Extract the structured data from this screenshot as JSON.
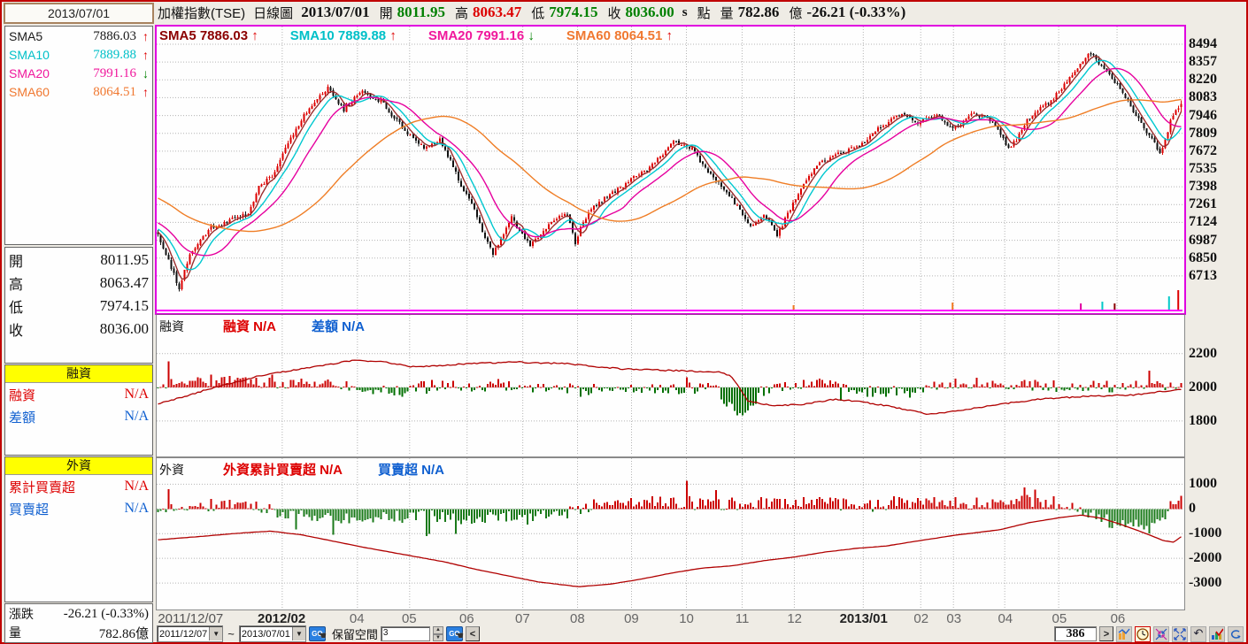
{
  "window": {
    "date_display": "2013/07/01"
  },
  "header": {
    "tokens": [
      {
        "text": "加權指數(TSE)",
        "cls": "t-title"
      },
      {
        "text": "日線圖",
        "cls": "t-title"
      },
      {
        "text": "2013/07/01",
        "cls": "t-date"
      },
      {
        "text": "開",
        "cls": "t-lab"
      },
      {
        "text": "8011.95",
        "cls": "t-num green"
      },
      {
        "text": "高",
        "cls": "t-lab"
      },
      {
        "text": "8063.47",
        "cls": "t-num red"
      },
      {
        "text": "低",
        "cls": "t-lab"
      },
      {
        "text": "7974.15",
        "cls": "t-num green"
      },
      {
        "text": "收",
        "cls": "t-lab"
      },
      {
        "text": "8036.00",
        "cls": "t-num green"
      },
      {
        "text": "s",
        "cls": "t-s"
      },
      {
        "text": "點",
        "cls": "t-lab"
      },
      {
        "text": "量",
        "cls": "t-lab"
      },
      {
        "text": "782.86",
        "cls": "t-num"
      },
      {
        "text": "億",
        "cls": "t-lab"
      },
      {
        "text": "-26.21 (-0.33%)",
        "cls": "t-num"
      }
    ]
  },
  "sidebar": {
    "sma_rows": [
      {
        "label": "SMA5",
        "value": "7886.03",
        "dir": "up",
        "color": "#1a1a1a"
      },
      {
        "label": "SMA10",
        "value": "7889.88",
        "dir": "up",
        "color": "#00c0c8"
      },
      {
        "label": "SMA20",
        "value": "7991.16",
        "dir": "down",
        "color": "#f0189c"
      },
      {
        "label": "SMA60",
        "value": "8064.51",
        "dir": "up",
        "color": "#f07830"
      }
    ],
    "ohlc_rows": [
      {
        "label": "開",
        "value": "8011.95"
      },
      {
        "label": "高",
        "value": "8063.47"
      },
      {
        "label": "低",
        "value": "7974.15"
      },
      {
        "label": "收",
        "value": "8036.00"
      }
    ],
    "margin_box": {
      "header": "融資",
      "rows": [
        {
          "label": "融資",
          "value": "N/A",
          "color": "#dd0000"
        },
        {
          "label": "差額",
          "value": "N/A",
          "color": "#1060d0"
        }
      ]
    },
    "foreign_box": {
      "header": "外資",
      "rows": [
        {
          "label": "累計買賣超",
          "value": "N/A",
          "color": "#dd0000"
        },
        {
          "label": "買賣超",
          "value": "N/A",
          "color": "#1060d0"
        }
      ]
    },
    "change_rows": [
      {
        "label": "漲跌",
        "value": "-26.21 (-0.33%)"
      },
      {
        "label": "量",
        "value": "782.86億"
      }
    ]
  },
  "panels": {
    "main": {
      "legend": [
        {
          "label": "SMA5",
          "value": "7886.03",
          "dir": "up",
          "color": "#8b0000"
        },
        {
          "label": "SMA10",
          "value": "7889.88",
          "dir": "up",
          "color": "#00c0c8"
        },
        {
          "label": "SMA20",
          "value": "7991.16",
          "dir": "down",
          "color": "#f0189c"
        },
        {
          "label": "SMA60",
          "value": "8064.51",
          "dir": "up",
          "color": "#f07830"
        }
      ],
      "y_ticks": [
        8494,
        8357,
        8220,
        8083,
        7946,
        7809,
        7672,
        7535,
        7398,
        7261,
        7124,
        6987,
        6850,
        6713
      ]
    },
    "mid": {
      "title": "融資",
      "legend": [
        {
          "label": "融資",
          "value": "N/A",
          "color": "#dd0000"
        },
        {
          "label": "差額",
          "value": "N/A",
          "color": "#1060d0"
        }
      ],
      "y_ticks": [
        2200,
        2000,
        1800
      ]
    },
    "bot": {
      "title": "外資",
      "legend": [
        {
          "label": "外資累計買賣超",
          "value": "N/A",
          "color": "#dd0000"
        },
        {
          "label": "買賣超",
          "value": "N/A",
          "color": "#1060d0"
        }
      ],
      "y_ticks": [
        1000,
        0,
        -1000,
        -2000,
        -3000
      ]
    }
  },
  "x_axis": {
    "labels": [
      {
        "text": "2011/12/07",
        "t": 0.002,
        "bold": false,
        "first": true
      },
      {
        "text": "2012/02",
        "t": 0.1224,
        "bold": true
      },
      {
        "text": "04",
        "t": 0.1957,
        "bold": false
      },
      {
        "text": "05",
        "t": 0.2466,
        "bold": false
      },
      {
        "text": "06",
        "t": 0.3026,
        "bold": false
      },
      {
        "text": "07",
        "t": 0.3569,
        "bold": false
      },
      {
        "text": "08",
        "t": 0.4103,
        "bold": false
      },
      {
        "text": "09",
        "t": 0.4629,
        "bold": false
      },
      {
        "text": "10",
        "t": 0.5164,
        "bold": false
      },
      {
        "text": "11",
        "t": 0.5707,
        "bold": false
      },
      {
        "text": "12",
        "t": 0.6216,
        "bold": false
      },
      {
        "text": "2013/01",
        "t": 0.6888,
        "bold": true
      },
      {
        "text": "02",
        "t": 0.7448,
        "bold": false
      },
      {
        "text": "03",
        "t": 0.7767,
        "bold": false
      },
      {
        "text": "04",
        "t": 0.8267,
        "bold": false
      },
      {
        "text": "05",
        "t": 0.8793,
        "bold": false
      },
      {
        "text": "06",
        "t": 0.9362,
        "bold": false
      }
    ]
  },
  "toolbar": {
    "from_date": "2011/12/07",
    "tilde": "~",
    "to_date": "2013/07/01",
    "go_label": "GO",
    "space_label": "保留空間",
    "space_value": "3",
    "back_label": "<",
    "count": "386",
    "forward_label": ">"
  },
  "chart_data": {
    "type": "candlestick",
    "title": "加權指數(TSE) 日線圖 2013/07/01",
    "candle_count": 386,
    "price_ylim": [
      6440,
      8630
    ],
    "last_candle": {
      "open": 8011.95,
      "high": 8063.47,
      "low": 7974.15,
      "close": 8036.0
    },
    "sma": [
      {
        "period": 5,
        "color": "#9b2d2d"
      },
      {
        "period": 10,
        "color": "#00c8d0"
      },
      {
        "period": 20,
        "color": "#e6009e"
      },
      {
        "period": 60,
        "color": "#ef7d25"
      }
    ],
    "up_color": "#dd0000",
    "down_color": "#111111",
    "price_anchors": [
      [
        0,
        7030
      ],
      [
        4,
        6830
      ],
      [
        8,
        6620
      ],
      [
        12,
        6870
      ],
      [
        15,
        6960
      ],
      [
        20,
        7080
      ],
      [
        25,
        7120
      ],
      [
        30,
        7170
      ],
      [
        34,
        7190
      ],
      [
        38,
        7400
      ],
      [
        43,
        7480
      ],
      [
        47,
        7650
      ],
      [
        51,
        7800
      ],
      [
        55,
        7950
      ],
      [
        58,
        8020
      ],
      [
        61,
        8100
      ],
      [
        64,
        8160
      ],
      [
        67,
        8060
      ],
      [
        70,
        7990
      ],
      [
        73,
        8060
      ],
      [
        77,
        8130
      ],
      [
        80,
        8080
      ],
      [
        84,
        8060
      ],
      [
        88,
        7950
      ],
      [
        92,
        7860
      ],
      [
        96,
        7760
      ],
      [
        100,
        7700
      ],
      [
        103,
        7730
      ],
      [
        106,
        7760
      ],
      [
        109,
        7640
      ],
      [
        112,
        7500
      ],
      [
        115,
        7370
      ],
      [
        118,
        7260
      ],
      [
        121,
        7120
      ],
      [
        124,
        6960
      ],
      [
        126,
        6880
      ],
      [
        129,
        7000
      ],
      [
        133,
        7160
      ],
      [
        136,
        7060
      ],
      [
        140,
        6940
      ],
      [
        143,
        7010
      ],
      [
        147,
        7110
      ],
      [
        151,
        7170
      ],
      [
        154,
        7190
      ],
      [
        156,
        7030
      ],
      [
        157,
        6950
      ],
      [
        159,
        7080
      ],
      [
        162,
        7210
      ],
      [
        166,
        7280
      ],
      [
        171,
        7350
      ],
      [
        175,
        7400
      ],
      [
        178,
        7460
      ],
      [
        182,
        7510
      ],
      [
        186,
        7560
      ],
      [
        190,
        7650
      ],
      [
        194,
        7740
      ],
      [
        198,
        7720
      ],
      [
        201,
        7690
      ],
      [
        205,
        7570
      ],
      [
        209,
        7460
      ],
      [
        213,
        7390
      ],
      [
        216,
        7310
      ],
      [
        220,
        7180
      ],
      [
        223,
        7090
      ],
      [
        226,
        7150
      ],
      [
        228,
        7190
      ],
      [
        231,
        7100
      ],
      [
        233,
        7020
      ],
      [
        236,
        7150
      ],
      [
        240,
        7310
      ],
      [
        244,
        7440
      ],
      [
        248,
        7560
      ],
      [
        252,
        7610
      ],
      [
        257,
        7660
      ],
      [
        261,
        7690
      ],
      [
        264,
        7710
      ],
      [
        268,
        7790
      ],
      [
        272,
        7860
      ],
      [
        276,
        7910
      ],
      [
        280,
        7960
      ],
      [
        283,
        7930
      ],
      [
        286,
        7890
      ],
      [
        290,
        7930
      ],
      [
        293,
        7960
      ],
      [
        296,
        7900
      ],
      [
        299,
        7840
      ],
      [
        303,
        7900
      ],
      [
        306,
        7960
      ],
      [
        310,
        7940
      ],
      [
        313,
        7910
      ],
      [
        317,
        7800
      ],
      [
        320,
        7690
      ],
      [
        323,
        7760
      ],
      [
        327,
        7910
      ],
      [
        331,
        7990
      ],
      [
        336,
        8060
      ],
      [
        340,
        8160
      ],
      [
        344,
        8260
      ],
      [
        348,
        8360
      ],
      [
        351,
        8430
      ],
      [
        354,
        8350
      ],
      [
        358,
        8260
      ],
      [
        362,
        8150
      ],
      [
        365,
        8050
      ],
      [
        368,
        7950
      ],
      [
        371,
        7850
      ],
      [
        374,
        7760
      ],
      [
        377,
        7670
      ],
      [
        379,
        7750
      ],
      [
        381,
        7900
      ],
      [
        383,
        7980
      ],
      [
        385,
        8036
      ]
    ],
    "margin_panel": {
      "ylim": [
        1600,
        2430
      ],
      "baseline": 2000,
      "line_color": "#b00000",
      "bar_up": "#cc0000",
      "bar_down": "#007000",
      "line_anchors": [
        [
          0,
          1900
        ],
        [
          0.05,
          1990
        ],
        [
          0.1,
          2070
        ],
        [
          0.15,
          2120
        ],
        [
          0.19,
          2160
        ],
        [
          0.22,
          2150
        ],
        [
          0.25,
          2120
        ],
        [
          0.3,
          2140
        ],
        [
          0.35,
          2150
        ],
        [
          0.4,
          2140
        ],
        [
          0.45,
          2110
        ],
        [
          0.5,
          2100
        ],
        [
          0.55,
          2090
        ],
        [
          0.56,
          2060
        ],
        [
          0.575,
          1920
        ],
        [
          0.6,
          1890
        ],
        [
          0.63,
          1900
        ],
        [
          0.66,
          1930
        ],
        [
          0.69,
          1910
        ],
        [
          0.72,
          1880
        ],
        [
          0.75,
          1840
        ],
        [
          0.78,
          1860
        ],
        [
          0.82,
          1900
        ],
        [
          0.86,
          1930
        ],
        [
          0.9,
          1945
        ],
        [
          0.95,
          1955
        ],
        [
          1,
          1990
        ]
      ]
    },
    "foreign_panel": {
      "ylim": [
        -4000,
        2050
      ],
      "baseline": 0,
      "line_color": "#b00000",
      "bar_up": "#cc0000",
      "bar_down": "#1a7a1a",
      "line_anchors": [
        [
          0,
          -1250
        ],
        [
          0.04,
          -1120
        ],
        [
          0.08,
          -980
        ],
        [
          0.11,
          -900
        ],
        [
          0.14,
          -1050
        ],
        [
          0.17,
          -1300
        ],
        [
          0.2,
          -1550
        ],
        [
          0.24,
          -1850
        ],
        [
          0.28,
          -2150
        ],
        [
          0.31,
          -2450
        ],
        [
          0.34,
          -2700
        ],
        [
          0.37,
          -2950
        ],
        [
          0.41,
          -3150
        ],
        [
          0.44,
          -3050
        ],
        [
          0.47,
          -2850
        ],
        [
          0.5,
          -2600
        ],
        [
          0.53,
          -2400
        ],
        [
          0.56,
          -2300
        ],
        [
          0.59,
          -2100
        ],
        [
          0.62,
          -1950
        ],
        [
          0.65,
          -1750
        ],
        [
          0.68,
          -1600
        ],
        [
          0.71,
          -1500
        ],
        [
          0.74,
          -1300
        ],
        [
          0.78,
          -1050
        ],
        [
          0.82,
          -850
        ],
        [
          0.85,
          -550
        ],
        [
          0.88,
          -350
        ],
        [
          0.9,
          -250
        ],
        [
          0.92,
          -380
        ],
        [
          0.94,
          -650
        ],
        [
          0.96,
          -950
        ],
        [
          0.98,
          -1280
        ],
        [
          0.99,
          -1350
        ],
        [
          1,
          -1050
        ]
      ],
      "big_green_end": true
    },
    "volume_ticks": [
      {
        "t": 0.62,
        "h": 5,
        "c": "#f07820"
      },
      {
        "t": 0.775,
        "h": 8,
        "c": "#f07820"
      },
      {
        "t": 0.9,
        "h": 7,
        "c": "#e000a0"
      },
      {
        "t": 0.921,
        "h": 9,
        "c": "#00c8c8"
      },
      {
        "t": 0.933,
        "h": 7,
        "c": "#8b0000"
      },
      {
        "t": 0.986,
        "h": 15,
        "c": "#00c8c8"
      },
      {
        "t": 0.995,
        "h": 22,
        "c": "#dd0000"
      }
    ]
  }
}
